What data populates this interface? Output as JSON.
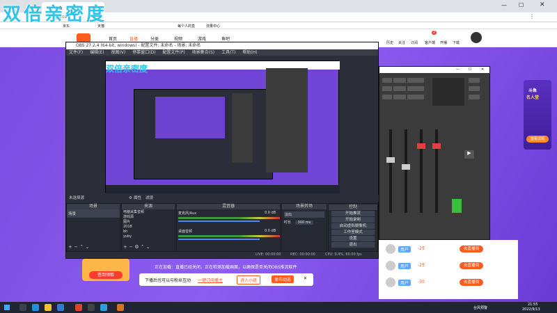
{
  "watermark": "双倍亲密度",
  "browser": {
    "tab_title": "斗鱼",
    "address_fragment": "yu.co",
    "bookmark_items": [
      "京东",
      "天猫",
      "每个人的直",
      "流量中心"
    ]
  },
  "site": {
    "nav": [
      "首页",
      "直播",
      "分类",
      "视频",
      "游戏",
      "鱼吧"
    ],
    "user_icons": [
      "历史",
      "关注",
      "订阅",
      "客户端",
      "开播",
      "下载"
    ],
    "badge_count": "2"
  },
  "obs": {
    "window_title": "OBS 27.2.4 (64-bit, windows) - 配置文件: 未命名 - 场景: 未命名",
    "menu": [
      "文件(F)",
      "编辑(E)",
      "视图(V)",
      "停靠窗口(D)",
      "配置文件(P)",
      "场景集合(S)",
      "工具(T)",
      "帮助(H)"
    ],
    "preview_bar_left": "未选择源",
    "preview_bar_props": "属性",
    "preview_bar_filters": "滤镜",
    "docks": {
      "scenes_header": "场景",
      "sources_header": "来源",
      "mixer_header": "混音器",
      "transitions_header": "场景转场",
      "controls_header": "控制"
    },
    "scene_item": "场景",
    "sources": [
      "电脑采集音频",
      "游戏源",
      "图片",
      "2018",
      "bh",
      "yuby"
    ],
    "mixer_channels": [
      {
        "name": "麦克风/Aux",
        "db": "0.0 dB"
      },
      {
        "name": "桌面音频",
        "db": "0.0 dB"
      }
    ],
    "transition": {
      "type": "淡出",
      "duration_label": "时长",
      "duration": "300 ms"
    },
    "controls": [
      "开始推流",
      "开始录制",
      "启动虚拟摄像机",
      "工作室模式",
      "设置",
      "退出"
    ],
    "status": [
      "LIVE: 00:00:00",
      "REC: 00:00:00",
      "CPU: 0.4%, 60.00 fps"
    ]
  },
  "banner": {
    "line": "正在加载：直播已经关闭，正在检测加载画面，以确保是否关闭OBS推流软件"
  },
  "follow_bar": {
    "text": "下播后也可以与粉丝互动",
    "link": "一键订阅播主",
    "btn1": "进入小组",
    "btn2": "发布动态"
  },
  "sidebar_ad": {
    "label": "签到领取"
  },
  "right_banner": {
    "line1": "斗鱼",
    "line2": "名人堂",
    "cta": "查看详情"
  },
  "chat": {
    "rows": [
      {
        "user": "用户",
        "score": "-25",
        "btn": "去直播间"
      },
      {
        "user": "用户",
        "score": "-25",
        "btn": "去直播间"
      },
      {
        "user": "用户",
        "score": "-30",
        "btn": "去直播间"
      }
    ]
  },
  "taskbar": {
    "weather": "台风预警",
    "time": "21:55",
    "date": "2022/9/13"
  },
  "colors": {
    "accent": "#ff5a1f",
    "purple": "#7a4be0",
    "watermark": "#2ec4e8"
  }
}
